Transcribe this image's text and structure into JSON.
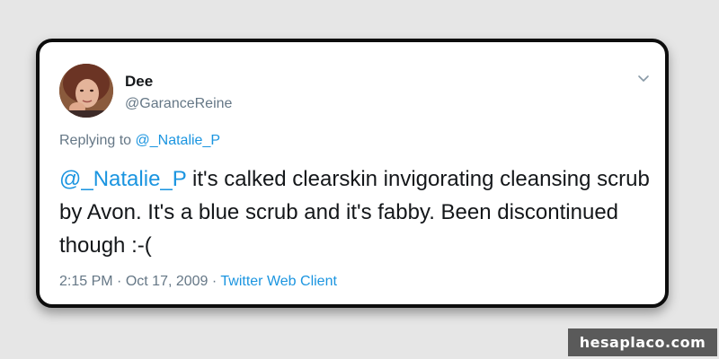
{
  "tweet": {
    "author_name": "Dee",
    "author_handle": "@GaranceReine",
    "replying_prefix": "Replying to",
    "replying_to": "@_Natalie_P",
    "mention": "@_Natalie_P",
    "text": " it's calked clearskin invigorating cleansing scrub by Avon. It's a blue scrub and it's fabby. Been discontinued though :-(",
    "time": "2:15 PM",
    "date": "Oct 17, 2009",
    "client": "Twitter Web Client",
    "separator": "·"
  },
  "watermark": {
    "text": "hesaplaco.com"
  },
  "icons": {
    "more_menu": "chevron-down-icon",
    "avatar": "profile-photo"
  },
  "colors": {
    "link": "#1b95e0",
    "secondary_text": "#657786",
    "primary_text": "#14171a",
    "background": "#e6e6e6",
    "watermark_bg": "#5a5a5a"
  }
}
